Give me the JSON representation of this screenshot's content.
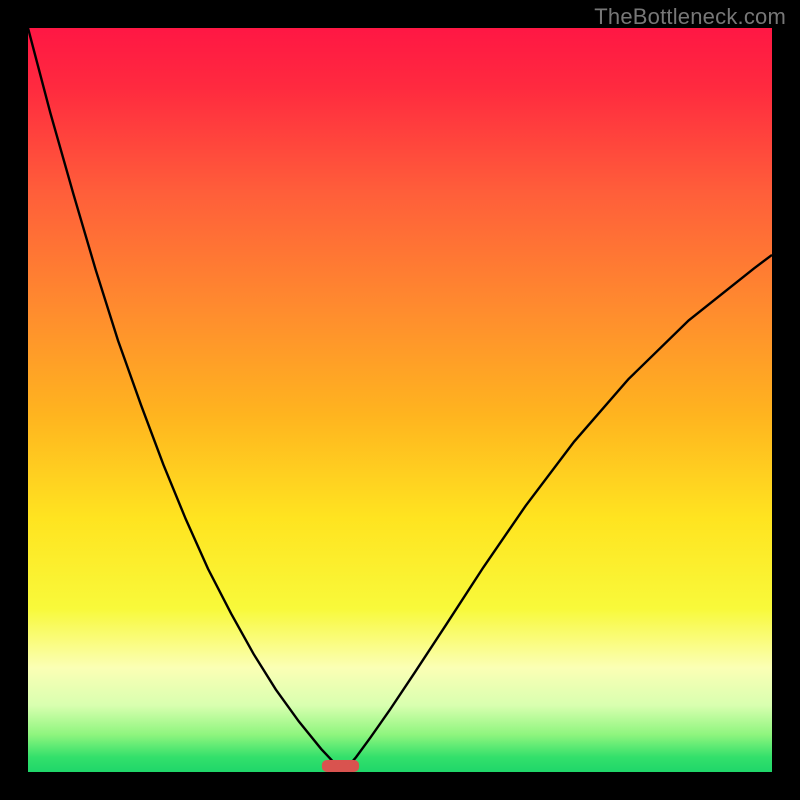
{
  "watermark": "TheBottleneck.com",
  "chart_data": {
    "type": "line",
    "title": "",
    "xlabel": "",
    "ylabel": "",
    "x_range": [
      0,
      100
    ],
    "y_range": [
      0,
      100
    ],
    "optimum_x": 42,
    "optimum_width": 5,
    "curve_left": {
      "x": [
        0.0,
        3.0,
        6.1,
        9.1,
        12.1,
        15.2,
        18.2,
        21.2,
        24.2,
        27.3,
        30.3,
        33.3,
        36.4,
        39.4,
        40.9,
        42.4
      ],
      "y": [
        100.0,
        88.6,
        77.7,
        67.5,
        58.0,
        49.3,
        41.3,
        34.0,
        27.3,
        21.3,
        15.9,
        11.1,
        6.8,
        3.1,
        1.5,
        0.0
      ]
    },
    "curve_right": {
      "x": [
        42.4,
        44.1,
        46.0,
        48.6,
        52.0,
        56.2,
        61.2,
        66.9,
        73.4,
        80.7,
        88.8,
        97.6,
        100.0
      ],
      "y": [
        0.0,
        2.0,
        4.6,
        8.3,
        13.4,
        19.8,
        27.5,
        35.8,
        44.4,
        52.8,
        60.7,
        67.7,
        69.5
      ]
    },
    "optimum_marker": {
      "x_center": 42,
      "y": 0,
      "width": 5,
      "color": "#d9534f"
    },
    "gradient_stops": [
      {
        "y_pct": 0,
        "color": "#ff1744"
      },
      {
        "y_pct": 8,
        "color": "#ff2a3f"
      },
      {
        "y_pct": 22,
        "color": "#ff5e3a"
      },
      {
        "y_pct": 38,
        "color": "#ff8c2e"
      },
      {
        "y_pct": 52,
        "color": "#ffb41f"
      },
      {
        "y_pct": 66,
        "color": "#ffe420"
      },
      {
        "y_pct": 78,
        "color": "#f8f93a"
      },
      {
        "y_pct": 86,
        "color": "#fbffb5"
      },
      {
        "y_pct": 91,
        "color": "#d9ffb0"
      },
      {
        "y_pct": 95,
        "color": "#8ef57e"
      },
      {
        "y_pct": 98,
        "color": "#33e06b"
      },
      {
        "y_pct": 100,
        "color": "#1fd66a"
      }
    ]
  }
}
